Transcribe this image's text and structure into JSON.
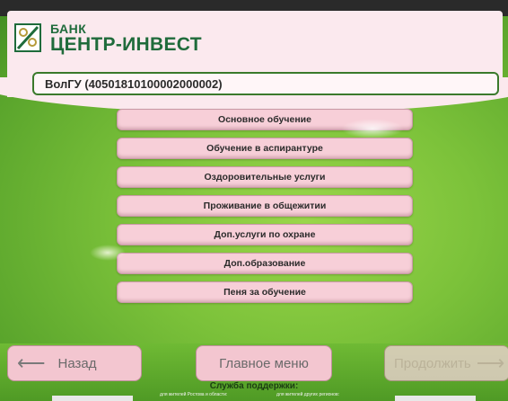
{
  "bank": {
    "line1": "БАНК",
    "line2": "ЦЕНТР-ИНВЕСТ"
  },
  "organization": {
    "label": "ВолГУ (40501810100002000002)"
  },
  "services": [
    "Основное обучение",
    "Обучение в аспирантуре",
    "Оздоровительные услуги",
    "Проживание в общежитии",
    "Доп.услуги по охране",
    "Доп.образование",
    "Пеня за обучение"
  ],
  "nav": {
    "back": "Назад",
    "main_menu": "Главное меню",
    "next": "Продолжить"
  },
  "support": {
    "title": "Служба поддержки:",
    "note_left": "для жителей Ростова и области:",
    "note_right": "для жителей других регионов:"
  },
  "colors": {
    "brand_green": "#1f6b3b",
    "button_pink": "#f7cfd8",
    "background_green": "#7cc23a"
  }
}
